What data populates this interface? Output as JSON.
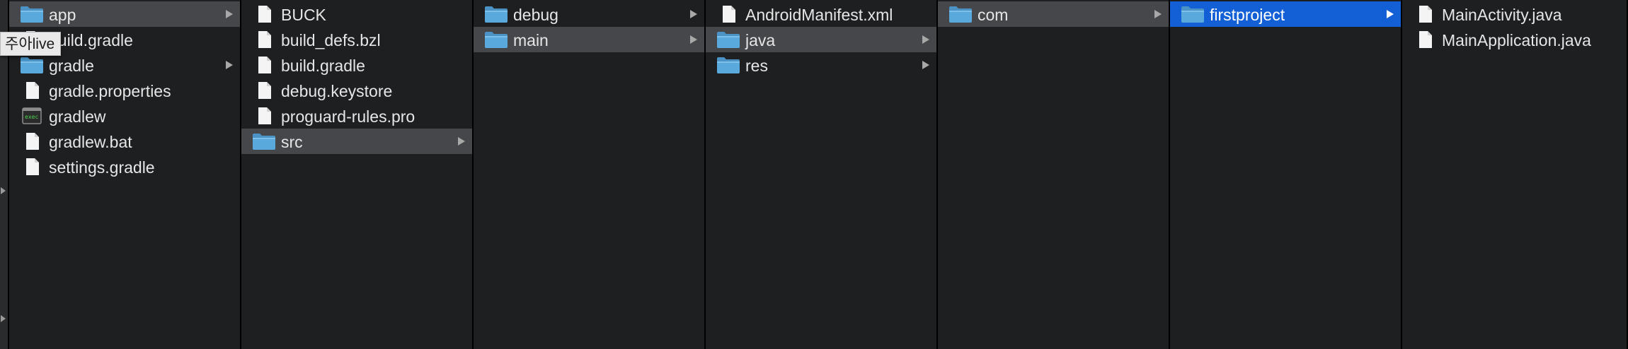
{
  "columns": [
    {
      "items": [
        {
          "label": "app",
          "icon": "folder-icon",
          "has_children": true,
          "selected": "gray"
        },
        {
          "label": "build.gradle",
          "icon": "file-icon",
          "has_children": false,
          "selected": ""
        },
        {
          "label": "gradle",
          "icon": "folder-icon",
          "has_children": true,
          "selected": ""
        },
        {
          "label": "gradle.properties",
          "icon": "file-icon",
          "has_children": false,
          "selected": ""
        },
        {
          "label": "gradlew",
          "icon": "terminal-exec-icon",
          "has_children": false,
          "selected": ""
        },
        {
          "label": "gradlew.bat",
          "icon": "file-icon",
          "has_children": false,
          "selected": ""
        },
        {
          "label": "settings.gradle",
          "icon": "file-icon",
          "has_children": false,
          "selected": ""
        }
      ]
    },
    {
      "items": [
        {
          "label": "BUCK",
          "icon": "file-icon",
          "has_children": false,
          "selected": ""
        },
        {
          "label": "build_defs.bzl",
          "icon": "file-icon",
          "has_children": false,
          "selected": ""
        },
        {
          "label": "build.gradle",
          "icon": "file-icon",
          "has_children": false,
          "selected": ""
        },
        {
          "label": "debug.keystore",
          "icon": "file-icon",
          "has_children": false,
          "selected": ""
        },
        {
          "label": "proguard-rules.pro",
          "icon": "file-icon",
          "has_children": false,
          "selected": ""
        },
        {
          "label": "src",
          "icon": "folder-icon",
          "has_children": true,
          "selected": "gray"
        }
      ]
    },
    {
      "items": [
        {
          "label": "debug",
          "icon": "folder-icon",
          "has_children": true,
          "selected": ""
        },
        {
          "label": "main",
          "icon": "folder-icon",
          "has_children": true,
          "selected": "gray"
        }
      ]
    },
    {
      "items": [
        {
          "label": "AndroidManifest.xml",
          "icon": "file-icon",
          "has_children": false,
          "selected": ""
        },
        {
          "label": "java",
          "icon": "folder-icon",
          "has_children": true,
          "selected": "gray"
        },
        {
          "label": "res",
          "icon": "folder-icon",
          "has_children": true,
          "selected": ""
        }
      ]
    },
    {
      "items": [
        {
          "label": "com",
          "icon": "folder-icon",
          "has_children": true,
          "selected": "gray"
        }
      ]
    },
    {
      "items": [
        {
          "label": "firstproject",
          "icon": "folder-icon",
          "has_children": true,
          "selected": "blue"
        }
      ]
    },
    {
      "items": [
        {
          "label": "MainActivity.java",
          "icon": "file-icon",
          "has_children": false,
          "selected": ""
        },
        {
          "label": "MainApplication.java",
          "icon": "file-icon",
          "has_children": false,
          "selected": ""
        }
      ]
    }
  ],
  "tooltip": {
    "text": "주아live"
  },
  "colors": {
    "background": "#1e1f21",
    "selection_gray": "#46474a",
    "selection_blue": "#1360d6",
    "folder": "#5aa9dc",
    "text": "#e6e6e6"
  }
}
